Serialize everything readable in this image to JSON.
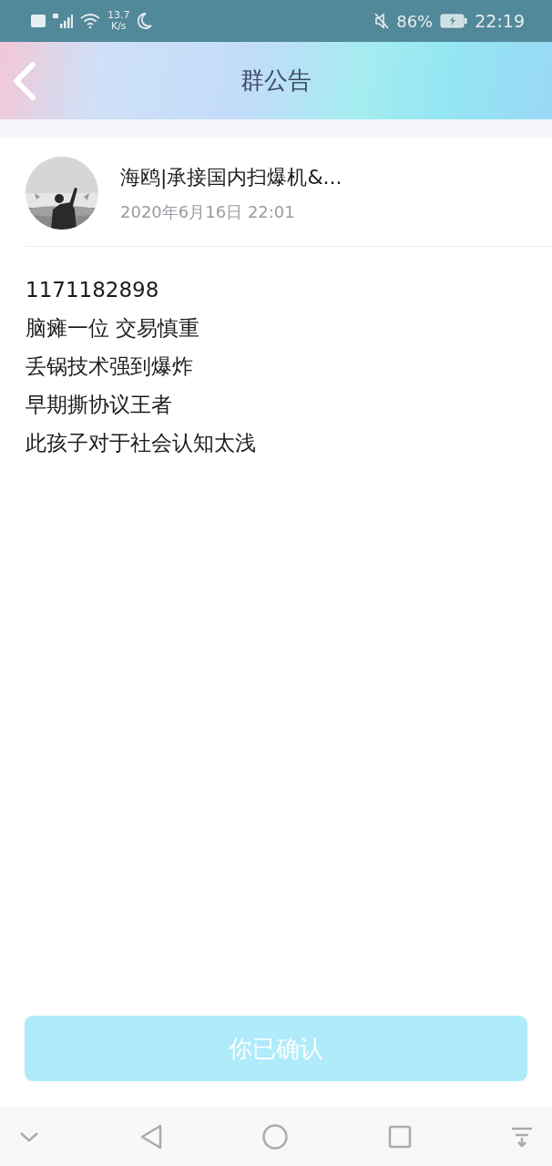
{
  "status_bar": {
    "speed_value": "13.7",
    "speed_unit": "K/s",
    "battery": "86%",
    "time": "22:19"
  },
  "header": {
    "title": "群公告"
  },
  "author": {
    "name": "海鸥|承接国内扫爆机&...",
    "date": "2020年6月16日 22:01"
  },
  "body_lines": [
    "1171182898",
    "脑瘫一位 交易慎重",
    "丢锅技术强到爆炸",
    "早期撕协议王者",
    "此孩子对于社会认知太浅"
  ],
  "confirm_button": {
    "label": "你已确认",
    "disabled": true
  }
}
